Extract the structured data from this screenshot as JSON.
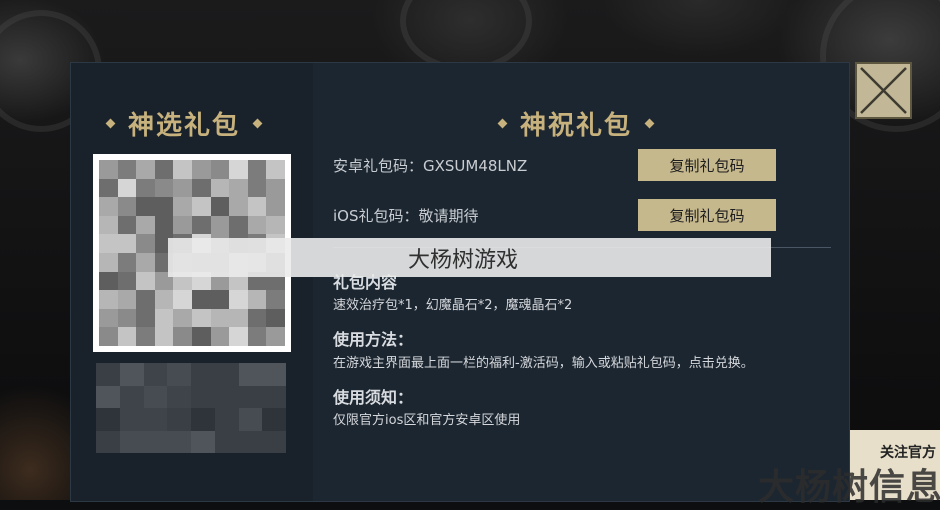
{
  "left": {
    "title": "神选礼包"
  },
  "right": {
    "title": "神祝礼包",
    "android": {
      "label": "安卓礼包码：GXSUM48LNZ",
      "button": "复制礼包码"
    },
    "ios": {
      "label": "iOS礼包码：敬请期待",
      "button": "复制礼包码"
    },
    "content_heading": "礼包内容",
    "content_text": "速效治疗包*1，幻魔晶石*2，魔魂晶石*2",
    "usage_heading": "使用方法：",
    "usage_text": "在游戏主界面最上面一栏的福利-激活码，输入或粘贴礼包码，点击兑换。",
    "notice_heading": "使用须知：",
    "notice_text": "仅限官方ios区和官方安卓区使用"
  },
  "close_icon": "close-x-icon",
  "watermark_text": "大杨树游戏",
  "corner_text": "关注官方",
  "bottom_watermark": "大杨树信息网",
  "colors": {
    "accent": "#c7b27e",
    "button": "#c6b88d",
    "modal_bg": "#1c2630"
  }
}
